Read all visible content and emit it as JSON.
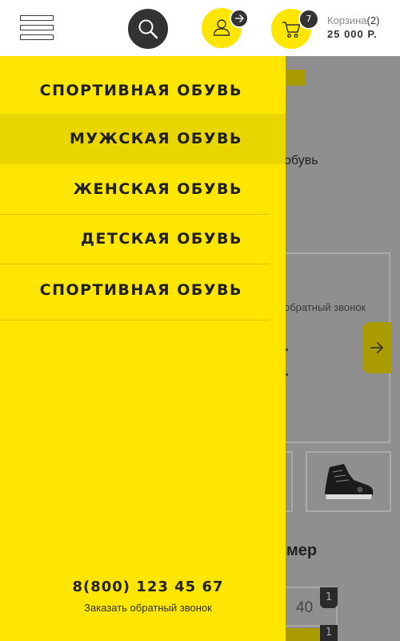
{
  "header": {
    "cart_label": "Корзина",
    "cart_count": "(2)",
    "cart_badge": "7",
    "cart_total": "25 000 Р."
  },
  "menu": {
    "items": [
      {
        "label": "СПОРТИВНАЯ ОБУВЬ"
      },
      {
        "label": "МУЖСКАЯ ОБУВЬ",
        "active": true
      },
      {
        "label": "ЖЕНСКАЯ ОБУВЬ"
      },
      {
        "label": "ДЕТСКАЯ ОБУВЬ"
      },
      {
        "label": "СПОРТИВНАЯ ОБУВЬ"
      }
    ],
    "phone": "8(800) 123 45 67",
    "callback": "Заказать обратный звонок"
  },
  "background": {
    "text_obuv": "обувь",
    "callback_fragment": "обратный звонок",
    "heading_fragment": "мер",
    "size_value": "40",
    "size_badge": "1",
    "size_badge2": "1"
  },
  "colors": {
    "accent": "#ffe600",
    "dark": "#333333"
  },
  "icons": [
    "burger-menu-icon",
    "search-icon",
    "user-icon",
    "arrow-right-icon",
    "cart-icon",
    "sneaker-image"
  ]
}
